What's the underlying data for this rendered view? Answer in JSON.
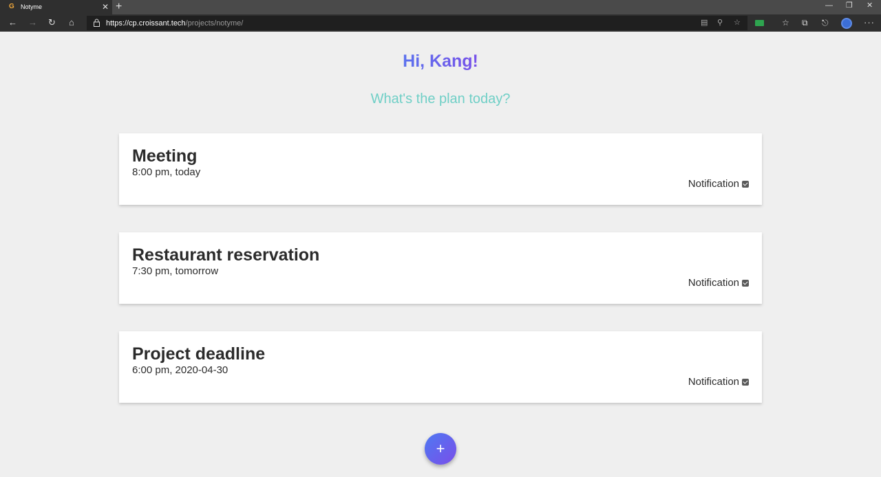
{
  "browser": {
    "tab_title": "Notyme",
    "tab_close": "✕",
    "new_tab": "+",
    "url_host": "https://cp.croissant.tech",
    "url_path": "/projects/notyme/",
    "window_min": "—",
    "window_restore": "❐",
    "window_close": "✕",
    "menu": "···"
  },
  "page": {
    "greeting": "Hi, Kang!",
    "subtitle": "What's the plan today?",
    "add_button": "+"
  },
  "cards": [
    {
      "title": "Meeting",
      "time": "8:00 pm, today",
      "notification_label": "Notification",
      "notification_checked": true
    },
    {
      "title": "Restaurant reservation",
      "time": "7:30 pm, tomorrow",
      "notification_label": "Notification",
      "notification_checked": true
    },
    {
      "title": "Project deadline",
      "time": "6:00 pm, 2020-04-30",
      "notification_label": "Notification",
      "notification_checked": true
    }
  ],
  "colors": {
    "greeting_gradient": [
      "#5a75ee",
      "#7a4ee9"
    ],
    "subtitle": "#6fcfc6",
    "fab_gradient": [
      "#4e79f2",
      "#7a4ee9"
    ],
    "background": "#efefef"
  },
  "icons": {
    "favicon": "croissant-icon",
    "back": "back-arrow-icon",
    "forward": "forward-arrow-icon",
    "refresh": "refresh-icon",
    "home": "home-icon",
    "lock": "lock-icon",
    "reader": "reader-view-icon",
    "zoom": "zoom-icon",
    "favorite": "star-icon",
    "extension": "extension-icon",
    "favorites_bar": "favorites-icon",
    "collections": "collections-icon",
    "share": "share-icon",
    "profile": "profile-avatar"
  }
}
